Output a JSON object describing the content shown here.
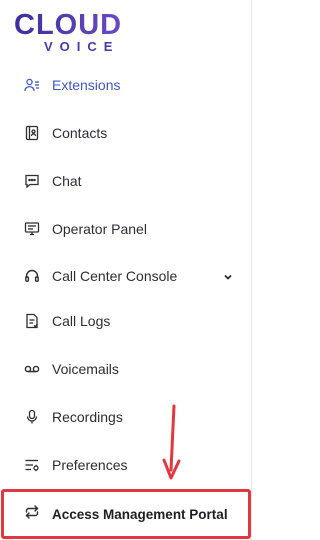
{
  "brand": {
    "line1": "CLOUD",
    "line2": "VOICE",
    "color": "#4a3aa8"
  },
  "sidebar": {
    "items": [
      {
        "label": "Extensions",
        "icon": "extensions-icon",
        "active": true
      },
      {
        "label": "Contacts",
        "icon": "contacts-icon"
      },
      {
        "label": "Chat",
        "icon": "chat-icon"
      },
      {
        "label": "Operator Panel",
        "icon": "operator-panel-icon"
      },
      {
        "label": "Call Center Console",
        "icon": "headset-icon",
        "has_dropdown": true
      },
      {
        "label": "Call Logs",
        "icon": "call-logs-icon"
      },
      {
        "label": "Voicemails",
        "icon": "voicemail-icon"
      },
      {
        "label": "Recordings",
        "icon": "microphone-icon"
      },
      {
        "label": "Preferences",
        "icon": "preferences-icon"
      }
    ],
    "highlighted_item": {
      "label": "Access Management Portal",
      "icon": "sync-icon"
    }
  },
  "colors": {
    "accent": "#3f57c7",
    "highlight_border": "#e0383e",
    "arrow": "#e0383e",
    "text": "#2d2d33"
  }
}
